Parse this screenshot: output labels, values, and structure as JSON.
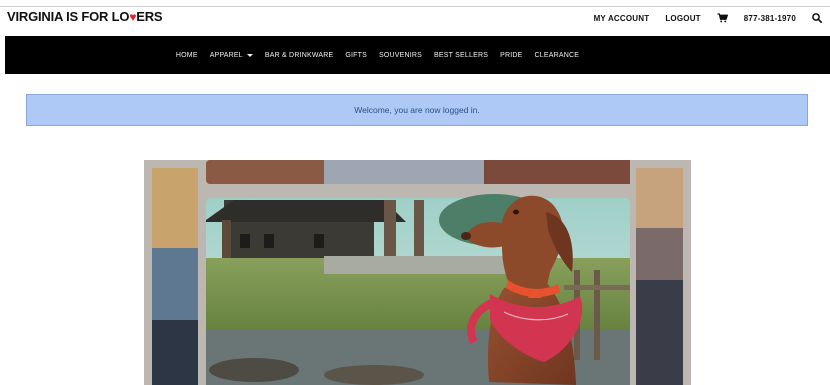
{
  "brand": {
    "logo_pre": "VIRGINIA IS FOR LO",
    "logo_post": "ERS",
    "logo_heart": "♥",
    "heart_color": "#e0232d"
  },
  "utility_nav": {
    "account": "MY ACCOUNT",
    "logout": "LOGOUT",
    "cart_icon": "shopping-cart-icon",
    "phone": "877-381-1970",
    "search_icon": "search-icon"
  },
  "main_nav": {
    "items": [
      {
        "label": "HOME"
      },
      {
        "label": "APPAREL",
        "has_dropdown": true
      },
      {
        "label": "BAR & DRINKWARE"
      },
      {
        "label": "GIFTS"
      },
      {
        "label": "SOUVENIRS"
      },
      {
        "label": "BEST SELLERS"
      },
      {
        "label": "PRIDE"
      },
      {
        "label": "CLEARANCE"
      }
    ],
    "background": "#000000"
  },
  "alert": {
    "message": "Welcome, you are now logged in.",
    "background": "#aec9f6"
  },
  "hero": {
    "subject": "dog with red bandana in front of framed landscape photo"
  }
}
